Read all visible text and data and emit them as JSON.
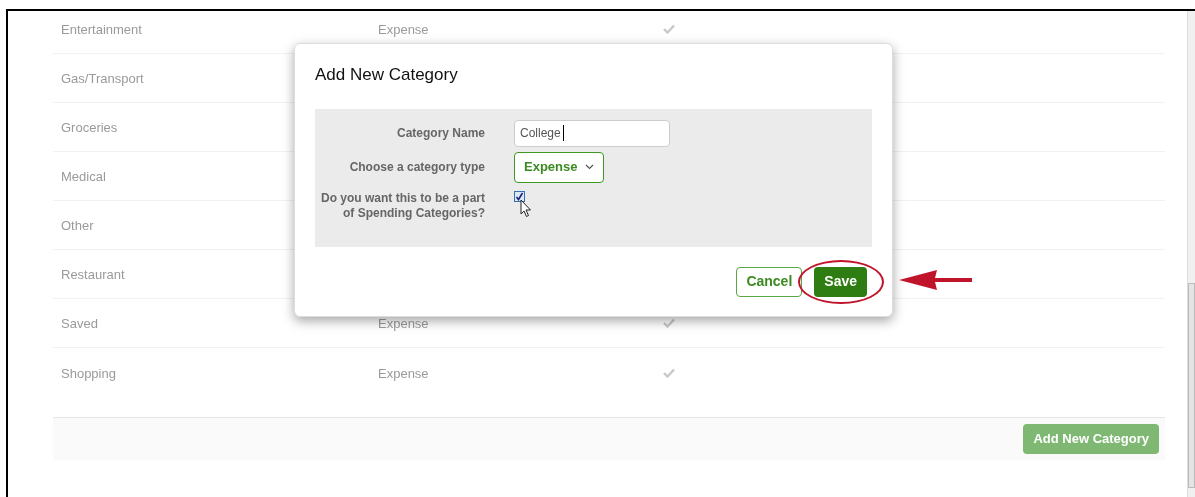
{
  "categories": [
    {
      "name": "Entertainment",
      "type": "Expense",
      "spending": true
    },
    {
      "name": "Gas/Transport"
    },
    {
      "name": "Groceries"
    },
    {
      "name": "Medical"
    },
    {
      "name": "Other"
    },
    {
      "name": "Restaurant"
    },
    {
      "name": "Saved",
      "type": "Expense",
      "spending": true
    },
    {
      "name": "Shopping",
      "type": "Expense",
      "spending": true
    }
  ],
  "add_button": {
    "label": "Add New Category",
    "disabled": true
  },
  "dialog": {
    "title": "Add New Category",
    "name_label": "Category Name",
    "name_value": "College",
    "type_label": "Choose a category type",
    "type_value": "Expense",
    "spending_label": "Do you want this to be a part of Spending Categories?",
    "spending_checked": true,
    "cancel": "Cancel",
    "save": "Save"
  }
}
